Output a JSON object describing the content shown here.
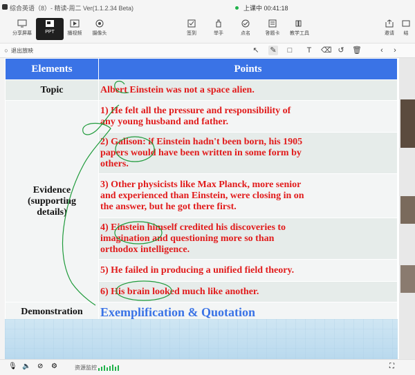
{
  "window": {
    "title": "综合英语（8）- 精读-周二 Ver(1.1.2.34 Beta)",
    "status": "上课中 00:41:18"
  },
  "toolbar": {
    "left": [
      "分享屏幕",
      "PPT",
      "播视频",
      "摄像头"
    ],
    "middle": [
      "签到",
      "举手",
      "点名",
      "答题卡",
      "教学工具"
    ],
    "right": [
      "邀请",
      "结"
    ]
  },
  "subbar": {
    "exit_label": "退出放映"
  },
  "table": {
    "headers": [
      "Elements",
      "Points"
    ],
    "topic": {
      "element": "Topic",
      "point": "Albert Einstein was not a space alien."
    },
    "evidence": {
      "element_lines": [
        "Evidence",
        "(supporting",
        "details)"
      ],
      "points": [
        [
          "1) He felt all the pressure and responsibility of",
          "any young husband and father."
        ],
        [
          "2) Galison: if Einstein hadn't been born, his 1905",
          "papers would have been written in some form by",
          "others."
        ],
        [
          "3) Other physicists like Max Planck, more senior",
          "and experienced than Einstein, were closing in on",
          "the answer, but he got there first."
        ],
        [
          "4) Einstein himself credited his discoveries to",
          "imagination and questioning more so than",
          "orthodox intelligence."
        ],
        [
          "5) He failed in producing a unified field theory."
        ],
        [
          "6) His brain looked much like another."
        ]
      ]
    },
    "demonstration": {
      "element": "Demonstration",
      "point": "Exemplification & Quotation"
    }
  },
  "statusbar": {
    "label": "资源监控"
  },
  "colors": {
    "header": "#3a73e6",
    "point_text": "#e11b1b",
    "demo_text": "#3a73e6",
    "ink": "#1e9a3a"
  }
}
